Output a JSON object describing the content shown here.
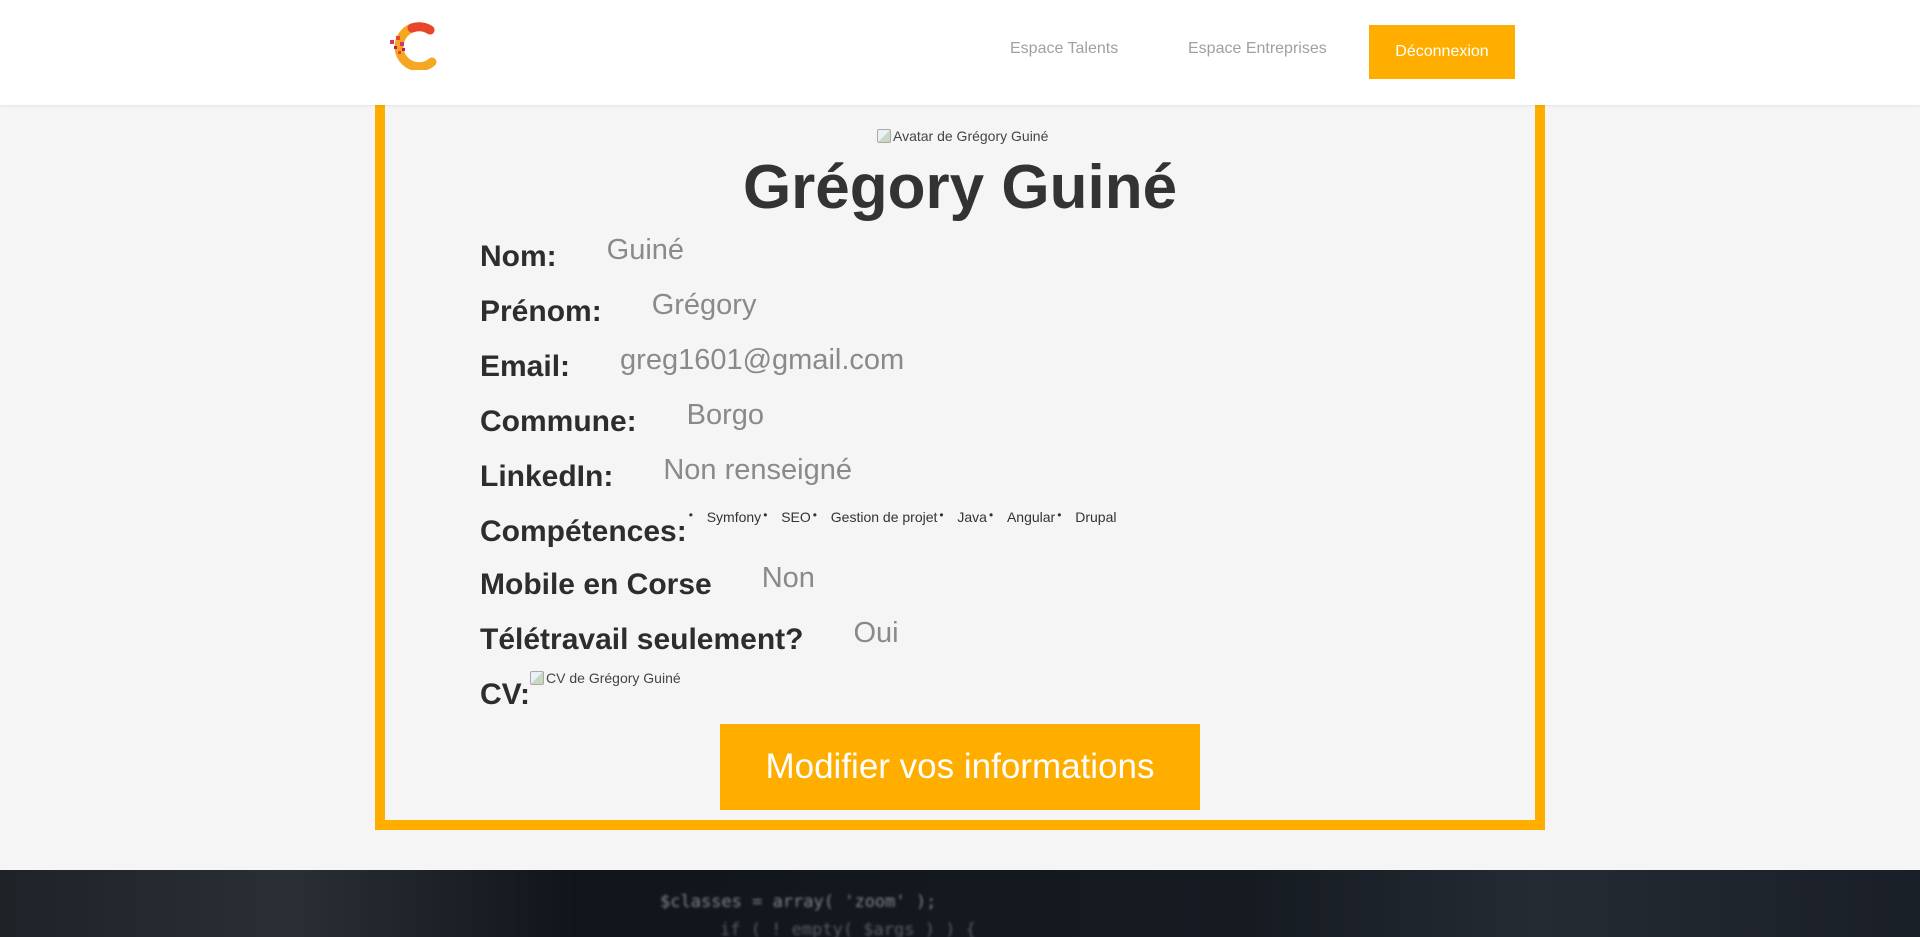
{
  "header": {
    "nav": [
      {
        "label": "Espace Talents"
      },
      {
        "label": "Espace Entreprises"
      }
    ],
    "logout_label": "Déconnexion"
  },
  "profile": {
    "avatar_alt": "Avatar de Grégory Guiné",
    "full_name": "Grégory Guiné",
    "fields": {
      "nom": {
        "label": "Nom:",
        "value": "Guiné"
      },
      "prenom": {
        "label": "Prénom:",
        "value": "Grégory"
      },
      "email": {
        "label": "Email:",
        "value": "greg1601@gmail.com"
      },
      "commune": {
        "label": "Commune:",
        "value": "Borgo"
      },
      "linkedin": {
        "label": "LinkedIn:",
        "value": "Non renseigné"
      },
      "competences": {
        "label": "Compétences:",
        "items": [
          "Symfony",
          "SEO",
          "Gestion de projet",
          "Java",
          "Angular",
          "Drupal"
        ]
      },
      "mobile": {
        "label": "Mobile en Corse",
        "value": "Non"
      },
      "teletravail": {
        "label": "Télétravail seulement?",
        "value": "Oui"
      },
      "cv": {
        "label": "CV:",
        "alt": "CV de Grégory Guiné"
      }
    },
    "edit_label": "Modifier vos informations"
  },
  "footer": {
    "code_line_1": "$classes = array( 'zoom' );",
    "code_line_2": "if ( ! empty( $args ) ) {"
  },
  "colors": {
    "accent": "#ffae00",
    "label": "#2d2d2d",
    "value": "#8a8a8a",
    "nav": "#a0a0a0"
  }
}
